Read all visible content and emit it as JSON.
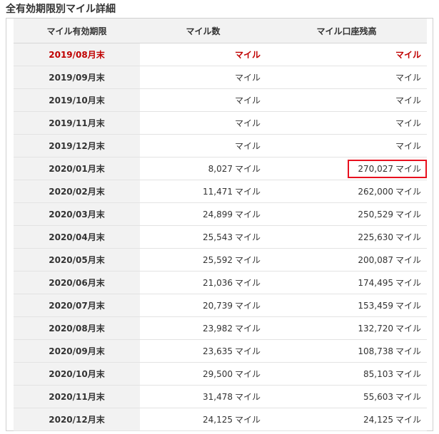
{
  "title": "全有効期限別マイル詳細",
  "table": {
    "headers": [
      "マイル有効期限",
      "マイル数",
      "マイル口座残高"
    ],
    "unit": "マイル",
    "rows": [
      {
        "date": "2019/08月末",
        "miles": "",
        "balance": "",
        "highlight": true,
        "boxed": false
      },
      {
        "date": "2019/09月末",
        "miles": "",
        "balance": "",
        "highlight": false,
        "boxed": false
      },
      {
        "date": "2019/10月末",
        "miles": "",
        "balance": "",
        "highlight": false,
        "boxed": false
      },
      {
        "date": "2019/11月末",
        "miles": "",
        "balance": "",
        "highlight": false,
        "boxed": false
      },
      {
        "date": "2019/12月末",
        "miles": "",
        "balance": "",
        "highlight": false,
        "boxed": false
      },
      {
        "date": "2020/01月末",
        "miles": "8,027",
        "balance": "270,027",
        "highlight": false,
        "boxed": true
      },
      {
        "date": "2020/02月末",
        "miles": "11,471",
        "balance": "262,000",
        "highlight": false,
        "boxed": false
      },
      {
        "date": "2020/03月末",
        "miles": "24,899",
        "balance": "250,529",
        "highlight": false,
        "boxed": false
      },
      {
        "date": "2020/04月末",
        "miles": "25,543",
        "balance": "225,630",
        "highlight": false,
        "boxed": false
      },
      {
        "date": "2020/05月末",
        "miles": "25,592",
        "balance": "200,087",
        "highlight": false,
        "boxed": false
      },
      {
        "date": "2020/06月末",
        "miles": "21,036",
        "balance": "174,495",
        "highlight": false,
        "boxed": false
      },
      {
        "date": "2020/07月末",
        "miles": "20,739",
        "balance": "153,459",
        "highlight": false,
        "boxed": false
      },
      {
        "date": "2020/08月末",
        "miles": "23,982",
        "balance": "132,720",
        "highlight": false,
        "boxed": false
      },
      {
        "date": "2020/09月末",
        "miles": "23,635",
        "balance": "108,738",
        "highlight": false,
        "boxed": false
      },
      {
        "date": "2020/10月末",
        "miles": "29,500",
        "balance": "85,103",
        "highlight": false,
        "boxed": false
      },
      {
        "date": "2020/11月末",
        "miles": "31,478",
        "balance": "55,603",
        "highlight": false,
        "boxed": false
      },
      {
        "date": "2020/12月末",
        "miles": "24,125",
        "balance": "24,125",
        "highlight": false,
        "boxed": false
      }
    ]
  },
  "colors": {
    "highlight_text": "#c00000",
    "box_border": "#e8101e",
    "header_bg": "#f2f2f2"
  }
}
